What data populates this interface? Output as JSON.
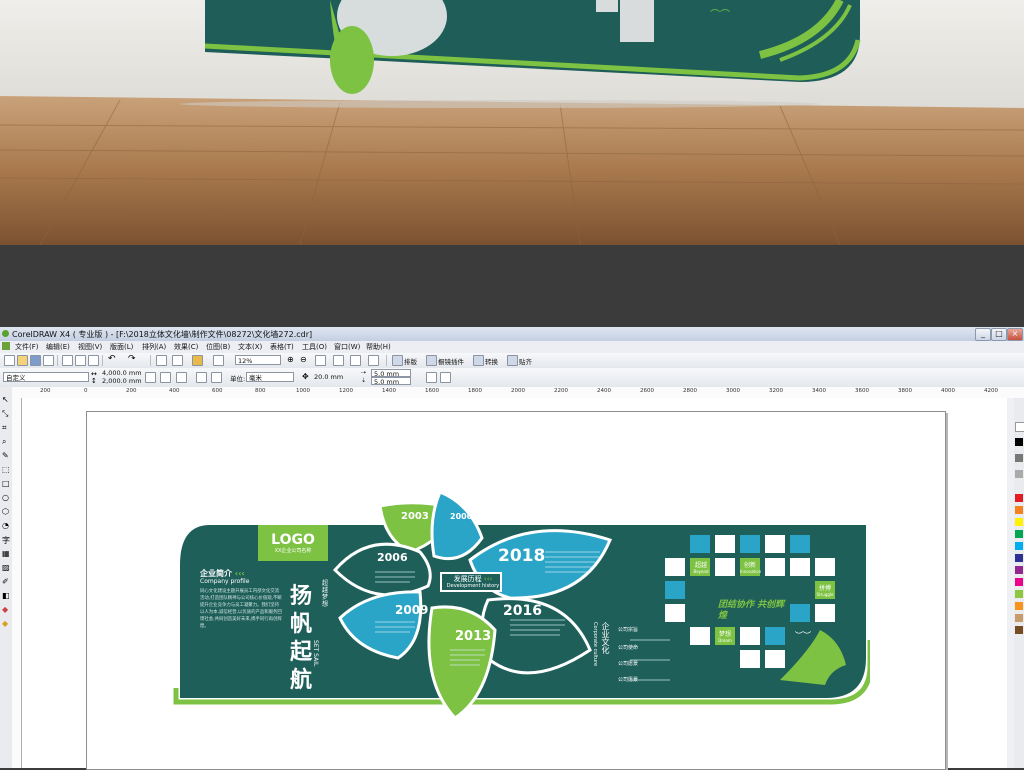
{
  "app": {
    "title": "CorelDRAW X4 ( 专业版 ) - [F:\\2018立体文化墙\\制作文件\\08272\\文化墙272.cdr]",
    "window_controls": [
      "_",
      "□",
      "×"
    ]
  },
  "menu": [
    "文件(F)",
    "编辑(E)",
    "视图(V)",
    "版面(L)",
    "排列(A)",
    "效果(C)",
    "位图(B)",
    "文本(X)",
    "表格(T)",
    "工具(O)",
    "窗口(W)",
    "帮助(H)"
  ],
  "toolbar": {
    "zoom": "12%",
    "buttons": [
      "排版",
      "橱镜插件",
      "转换",
      "贴齐"
    ]
  },
  "propbar": {
    "preset": "自定义",
    "width": "4,000.0 mm",
    "height": "2,000.0 mm",
    "unit_label": "单位:",
    "unit": "毫米",
    "nudge": "20.0 mm",
    "dup_x": "5.0 mm",
    "dup_y": "5.0 mm"
  },
  "ruler": {
    "ticks": [
      "200",
      "0",
      "200",
      "400",
      "600",
      "800",
      "1000",
      "1200",
      "1400",
      "1600",
      "1800",
      "2000",
      "2200",
      "2400",
      "2600",
      "2800",
      "3000",
      "3200",
      "3400",
      "3600",
      "3800",
      "4000",
      "4200"
    ]
  },
  "design": {
    "logo": "LOGO",
    "logo_sub": "XX企业公司名称",
    "profile_title": "企业简介",
    "profile_en": "Company profile",
    "slogan": "扬帆起航",
    "slogan_small": "超越梦想",
    "slogan_en": "SET SAIL",
    "profile_text": "同心文化建设主题开展员工内部文化交流活动,打造团队精神与公司核心价值观,不断提升企业竞争力与员工凝聚力。我们坚持以人为本,诚信经营,以优质的产品和服务回馈社会,共同创造美好未来,携手同行再创辉煌。",
    "center_label": "发展历程",
    "center_label_en": "Development history",
    "years": [
      "2003",
      "2000",
      "2006",
      "2018",
      "2009",
      "2016",
      "2013"
    ],
    "culture_title": "企业文化",
    "culture_en": "Corporate culture",
    "culture_items": [
      "公司宗旨",
      "公司使命",
      "公司愿景",
      "公司愿景"
    ],
    "grid_labels": [
      {
        "cn": "超越",
        "en": "Beyond"
      },
      {
        "cn": "创新",
        "en": "Innovation"
      },
      {
        "cn": "拼搏",
        "en": "Struggle"
      },
      {
        "cn": "梦想",
        "en": "Dream"
      }
    ],
    "calligraphy": "团结协作 共创辉煌"
  },
  "colors": {
    "teal_dark": "#1f5f5a",
    "green": "#7dc242",
    "cyan": "#2aa5c8",
    "page_bg": "#ffffff"
  }
}
